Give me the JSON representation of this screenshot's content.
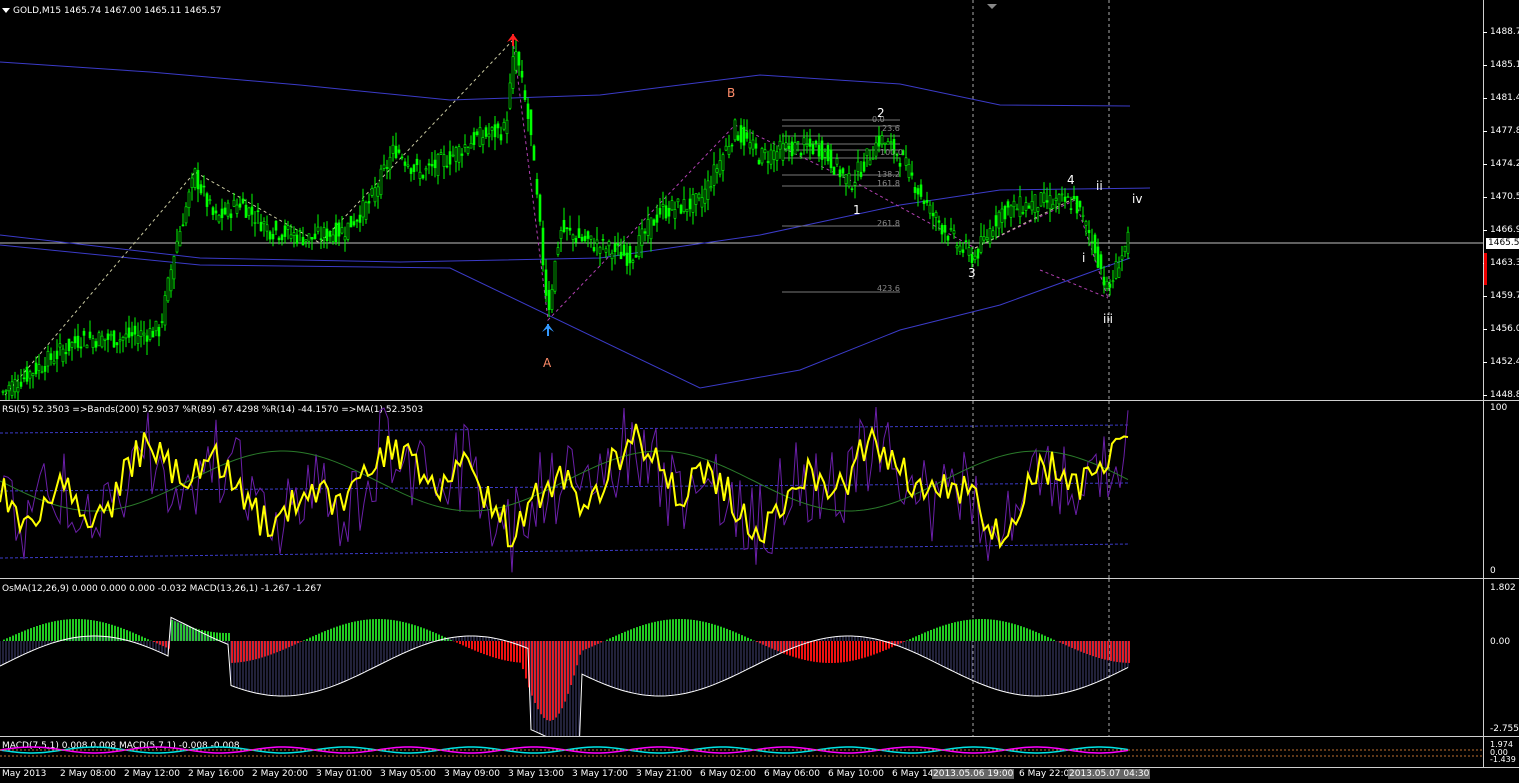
{
  "symbol_header": "GOLD,M15  1465.74 1467.00 1465.11 1465.57",
  "current_price": "1465.5",
  "price_axis": [
    "1488.7",
    "1485.1",
    "1481.4",
    "1477.8",
    "1474.2",
    "1470.5",
    "1466.9",
    "1463.3",
    "1459.7",
    "1456.0",
    "1452.4",
    "1448.8"
  ],
  "rsi_header": "RSI(5) 52.3503   =>Bands(200) 52.9037   %R(89) -67.4298   %R(14) -44.1570   =>MA(1) 52.3503",
  "rsi_axis": [
    "100",
    "0"
  ],
  "osma_header": "OsMA(12,26,9) 0.000 0.000 0.000 -0.032   MACD(13,26,1) -1.267 -1.267",
  "osma_axis": [
    "1.802",
    "0.00",
    "-2.755"
  ],
  "macd2_header": "MACD(7,5,1) 0.008 0.008   MACD(5,7,1) -0.008 -0.008",
  "macd2_axis": [
    "1.974",
    "0.00",
    "-1.439"
  ],
  "time_axis": [
    "May 2013",
    "2 May 08:00",
    "2 May 12:00",
    "2 May 16:00",
    "2 May 20:00",
    "3 May 01:00",
    "3 May 05:00",
    "3 May 09:00",
    "3 May 13:00",
    "3 May 17:00",
    "3 May 21:00",
    "6 May 02:00",
    "6 May 06:00",
    "6 May 10:00",
    "6 May 14"
  ],
  "time_highlight_1": "2013.05.06 19:00",
  "time_axis_mid": "6 May 22:00",
  "time_highlight_2": "2013.05.07 04:30",
  "wave_labels": {
    "A": "A",
    "B": "B",
    "w1": "1",
    "w2": "2",
    "w3": "3",
    "w4": "4",
    "wi": "i",
    "wii": "ii",
    "wiii": "iii",
    "wiv": "iv"
  },
  "fib_levels": [
    "0.0",
    "23.6",
    "38.2",
    "50.0",
    "61.8",
    "100.0",
    "138.2",
    "161.8",
    "261.8",
    "423.6"
  ],
  "colors": {
    "bull": "#00ff00",
    "bear": "#ff0000",
    "rsi": "#ffff00",
    "band": "#3b3bc8",
    "osma_up": "#22cc22",
    "osma_down": "#ee1111",
    "macd_line": "#ffffff",
    "macd2_cyan": "#00e5e5",
    "macd2_magenta": "#ff00ff"
  }
}
